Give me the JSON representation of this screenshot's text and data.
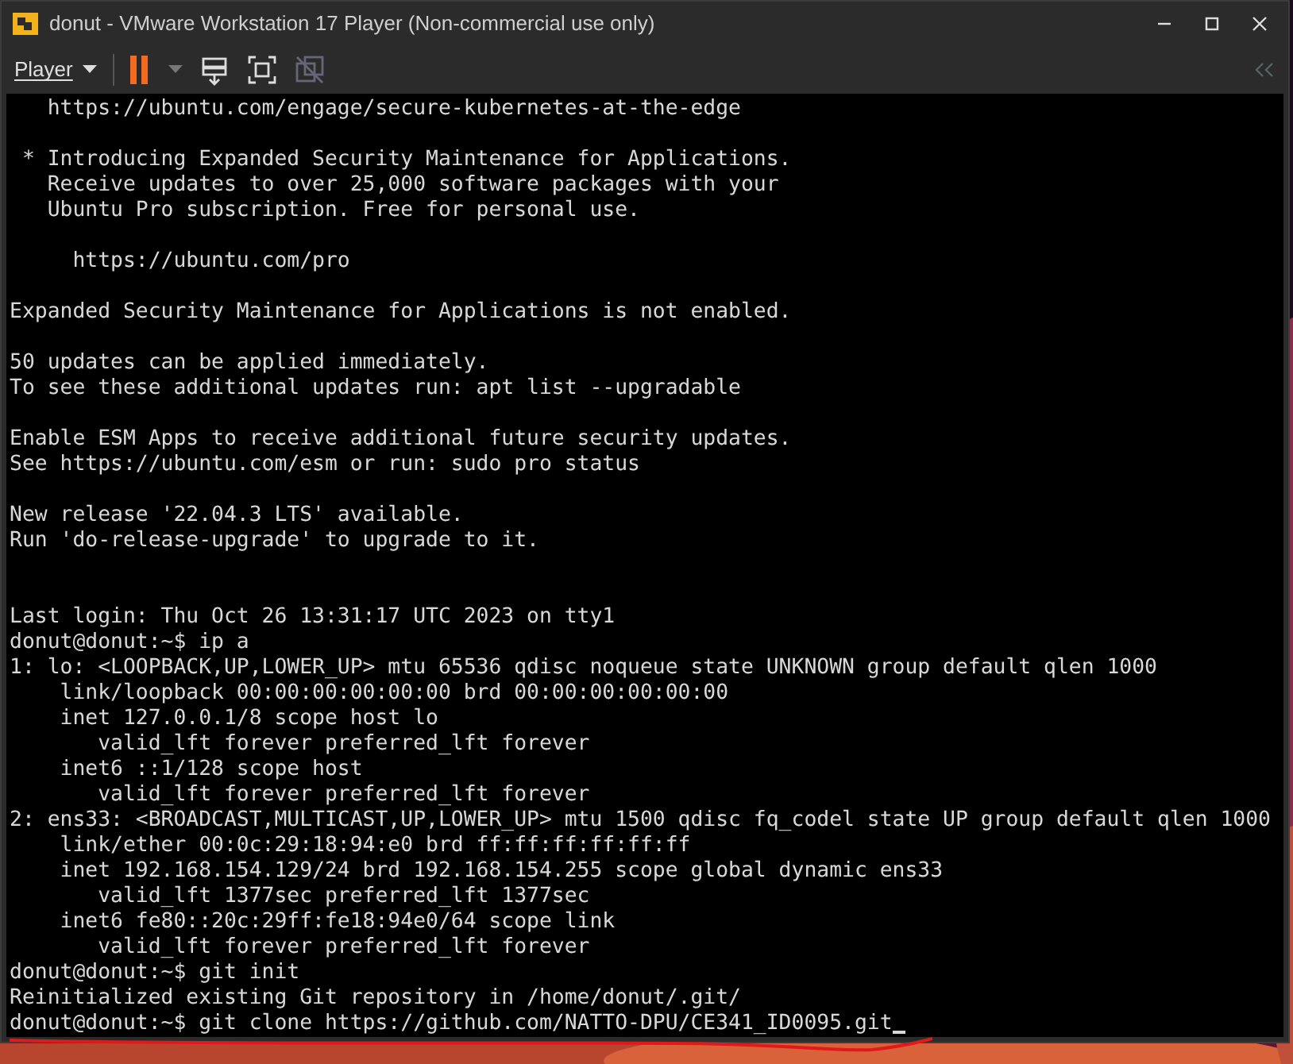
{
  "window": {
    "title": "donut - VMware Workstation 17 Player (Non-commercial use only)"
  },
  "toolbar": {
    "menu_label": "Player"
  },
  "terminal": {
    "blocks": [
      {
        "kind": "normal",
        "lines": [
          "   https://ubuntu.com/engage/secure-kubernetes-at-the-edge"
        ]
      },
      {
        "kind": "normal",
        "lines": [
          " * Introducing Expanded Security Maintenance for Applications.",
          "   Receive updates to over 25,000 software packages with your",
          "   Ubuntu Pro subscription. Free for personal use."
        ]
      },
      {
        "kind": "normal",
        "lines": [
          "     https://ubuntu.com/pro"
        ]
      },
      {
        "kind": "normal",
        "lines": [
          "Expanded Security Maintenance for Applications is not enabled."
        ]
      },
      {
        "kind": "normal",
        "lines": [
          "50 updates can be applied immediately.",
          "To see these additional updates run: apt list --upgradable"
        ]
      },
      {
        "kind": "normal",
        "lines": [
          "Enable ESM Apps to receive additional future security updates.",
          "See https://ubuntu.com/esm or run: sudo pro status"
        ]
      },
      {
        "kind": "normal",
        "lines": [
          "New release '22.04.3 LTS' available.",
          "Run 'do-release-upgrade' to upgrade to it."
        ]
      },
      {
        "kind": "wide_gap",
        "lines": [
          "Last login: Thu Oct 26 13:31:17 UTC 2023 on tty1",
          "donut@donut:~$ ip a",
          "1: lo: <LOOPBACK,UP,LOWER_UP> mtu 65536 qdisc noqueue state UNKNOWN group default qlen 1000",
          "    link/loopback 00:00:00:00:00:00 brd 00:00:00:00:00:00",
          "    inet 127.0.0.1/8 scope host lo",
          "       valid_lft forever preferred_lft forever",
          "    inet6 ::1/128 scope host",
          "       valid_lft forever preferred_lft forever",
          "2: ens33: <BROADCAST,MULTICAST,UP,LOWER_UP> mtu 1500 qdisc fq_codel state UP group default qlen 1000",
          "    link/ether 00:0c:29:18:94:e0 brd ff:ff:ff:ff:ff:ff",
          "    inet 192.168.154.129/24 brd 192.168.154.255 scope global dynamic ens33",
          "       valid_lft 1377sec preferred_lft 1377sec",
          "    inet6 fe80::20c:29ff:fe18:94e0/64 scope link",
          "       valid_lft forever preferred_lft forever",
          "donut@donut:~$ git init",
          "Reinitialized existing Git repository in /home/donut/.git/",
          "donut@donut:~$ git clone https://github.com/NATTO-DPU/CE341_ID0095.git"
        ]
      }
    ]
  }
}
